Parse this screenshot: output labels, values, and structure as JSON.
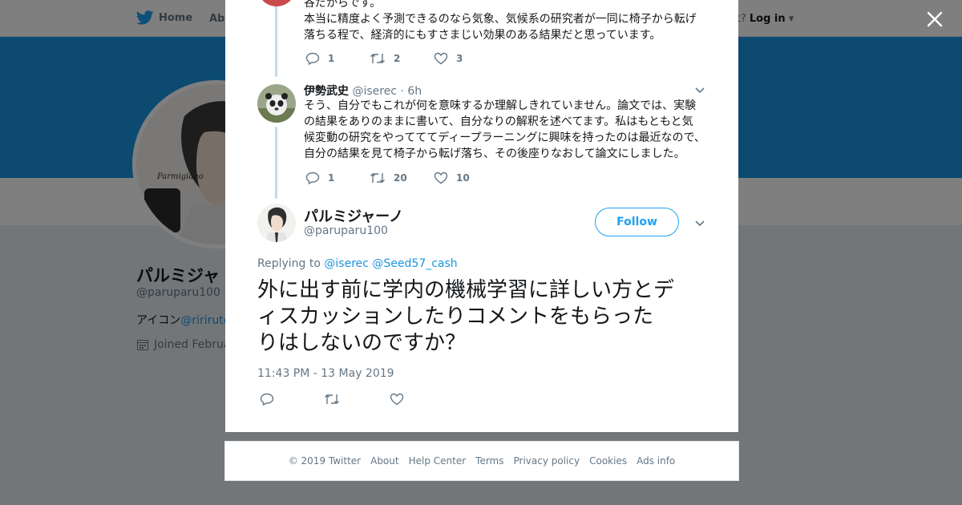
{
  "background": {
    "nav": {
      "home": "Home",
      "about": "Abo",
      "account_prompt": "ccount?",
      "login": "Log in"
    },
    "profile": {
      "name": "パルミジャ",
      "handle": "@paruparu100",
      "bio_prefix": "アイコン",
      "bio_link": "@ririruto",
      "joined": "Joined Februa",
      "avatar_text": "Parmigiano"
    },
    "colors": {
      "banner": "#1b95e0",
      "overlay": "rgba(0,0,0,0.5)"
    }
  },
  "close_icon": "close-icon",
  "thread": {
    "tweet1": {
      "lines": [
        "谷だからです。",
        "本当に精度よく予測できるのなら気象、気候系の研究者が一同に椅子から転げ",
        "落ちる程で、経済的にもすさまじい効果のある結果だと思っています。"
      ],
      "replies": "1",
      "retweets": "2",
      "likes": "3"
    },
    "tweet2": {
      "name": "伊勢武史",
      "handle": "@iserec",
      "time": "· 6h",
      "lines": [
        "そう、自分でもこれが何を意味するか理解しきれていません。論文では、実験",
        "の結果をありのままに書いて、自分なりの解釈を述べてます。私はもともと気",
        "候変動の研究をやってててディープラーニングに興味を持ったのは最近なので、",
        "自分の結果を見て椅子から転げ落ち、その後座りなおして論文にしました。"
      ],
      "replies": "1",
      "retweets": "20",
      "likes": "10"
    }
  },
  "main_tweet": {
    "name": "パルミジャーノ",
    "handle": "@paruparu100",
    "follow_label": "Follow",
    "replying_label": "Replying to",
    "replying_to": [
      "@iserec",
      "@Seed57_cash"
    ],
    "text_lines": [
      "外に出す前に学内の機械学習に詳しい方とデ",
      "ィスカッションしたりコメントをもらった",
      "りはしないのですか？"
    ],
    "timestamp": "11:43 PM - 13 May 2019"
  },
  "footer": {
    "links": [
      "© 2019 Twitter",
      "About",
      "Help Center",
      "Terms",
      "Privacy policy",
      "Cookies",
      "Ads info"
    ]
  }
}
